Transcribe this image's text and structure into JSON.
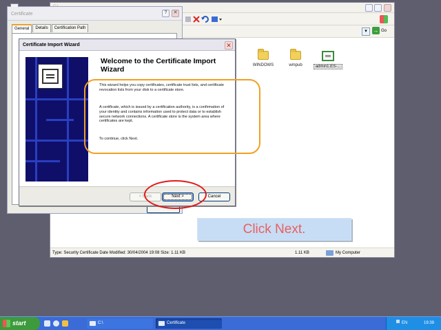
{
  "explorer": {
    "title": "C:\\",
    "address_go": "Go",
    "address_dropdown_glyph": "▾",
    "items": [
      {
        "label": "WINDOWS"
      },
      {
        "label": "wmpub"
      },
      {
        "label": "admin1.ES-..."
      }
    ],
    "status": {
      "details": "Type: Security Certificate Date Modified: 30/04/2004 19:08 Size: 1.11 KB",
      "size": "1.11 KB",
      "zone": "My Computer"
    }
  },
  "cert_dialog": {
    "title": "Certificate",
    "tabs": [
      {
        "label": "General"
      },
      {
        "label": "Details"
      },
      {
        "label": "Certification Path"
      }
    ]
  },
  "wizard": {
    "title": "Certificate Import Wizard",
    "close_glyph": "✕",
    "heading": "Welcome to the Certificate Import Wizard",
    "paragraphs": [
      "This wizard helps you copy certificates, certificate trust lists, and certificate revocation lists from your disk to a certificate store.",
      "A certificate, which is issued by a certification authority, is a confirmation of your identity and contains information used to protect data or to establish secure network connections. A certificate store is the system area where certificates are kept.",
      "To continue, click Next."
    ],
    "buttons": {
      "back": "< Back",
      "next": "Next >",
      "cancel": "Cancel"
    }
  },
  "callout": {
    "text": "Click Next."
  },
  "taskbar": {
    "start": "start",
    "tasks": [
      {
        "label": "C:\\"
      },
      {
        "label": "Certificate"
      }
    ],
    "language": "EN",
    "clock": "19:39"
  },
  "colors": {
    "highlight_orange": "#f0a020",
    "circle_red": "#e01818",
    "callout_bg": "#c7ddf5",
    "callout_text": "#e86060",
    "taskbar_blue": "#3a6bd6",
    "start_green": "#3d9a3d",
    "wizard_side_navy": "#0f0f6a"
  }
}
